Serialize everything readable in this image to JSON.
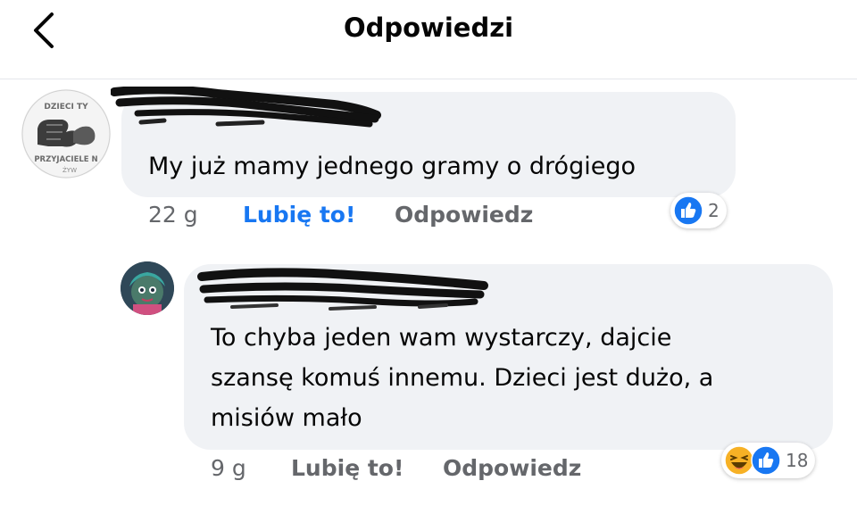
{
  "header": {
    "title": "Odpowiedzi",
    "back_icon": "chevron-left-icon"
  },
  "comments": [
    {
      "avatar_icon": "fist-bump-avatar",
      "avatar_texts": [
        "DZIECI TY",
        "PRZYJACIELE N",
        "ŻYW"
      ],
      "author_redacted": true,
      "text": "My już mamy jednego gramy o drógiego",
      "time": "22 g",
      "like_label": "Lubię to!",
      "reply_label": "Odpowiedz",
      "like_active": true,
      "reactions": {
        "icons": [
          "like-icon"
        ],
        "count": "2"
      }
    },
    {
      "avatar_icon": "cartoon-character-avatar",
      "author_redacted": true,
      "text": "To chyba jeden wam wystarczy, dajcie\nszansę komuś innemu. Dzieci jest dużo, a\nmisiów mało",
      "time": "9 g",
      "like_label": "Lubię to!",
      "reply_label": "Odpowiedz",
      "like_active": false,
      "reactions": {
        "icons": [
          "haha-icon",
          "like-icon"
        ],
        "count": "18"
      }
    }
  ],
  "colors": {
    "like_blue": "#1877f2",
    "bubble_bg": "#f0f2f5",
    "muted_text": "#65676b",
    "haha_yellow": "#f7b125"
  }
}
